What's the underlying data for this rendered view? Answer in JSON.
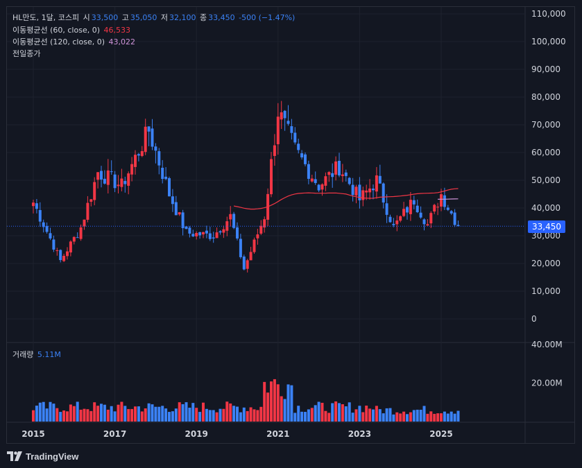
{
  "header": {
    "symbol": "HL만도, 1달, 코스피",
    "open_label": "시",
    "open": "33,500",
    "high_label": "고",
    "high": "35,050",
    "low_label": "저",
    "low": "32,100",
    "close_label": "종",
    "close": "33,450",
    "change": "-500 (−1.47%)"
  },
  "indicators": [
    {
      "label": "이동평균선 (60, close, 0)",
      "value": "46,533",
      "color": "#f23645"
    },
    {
      "label": "이동평균선 (120, close, 0)",
      "value": "43,022",
      "color": "#ce93d8"
    },
    {
      "label": "전일종가",
      "value": "",
      "color": "#d1d4dc"
    }
  ],
  "volume_pane": {
    "label": "거래량",
    "value": "5.11M"
  },
  "current_price_tag": "33,450",
  "brand": "TradingView",
  "colors": {
    "up": "#f23645",
    "down": "#3b82f6",
    "ma60": "#f23645",
    "ma120": "#ce93d8",
    "grid": "#1e222d",
    "axis_text": "#d1d4dc"
  },
  "chart_data": {
    "type": "candlestick",
    "price_axis": {
      "ticks": [
        "110,000",
        "100,000",
        "90,000",
        "80,000",
        "70,000",
        "60,000",
        "50,000",
        "40,000",
        "30,000",
        "20,000",
        "10,000",
        "0"
      ],
      "range": [
        0,
        110000
      ]
    },
    "volume_axis": {
      "ticks": [
        "40.00M",
        "20.00M"
      ],
      "range": [
        0,
        40000000
      ]
    },
    "x_axis": {
      "ticks": [
        "2015",
        "2017",
        "2019",
        "2021",
        "2023",
        "2025"
      ]
    },
    "last_close": 33450,
    "yearly_path": [
      {
        "date": "2015-01",
        "price": 42000
      },
      {
        "date": "2015-06",
        "price": 29000
      },
      {
        "date": "2015-09",
        "price": 21000
      },
      {
        "date": "2016-03",
        "price": 33000
      },
      {
        "date": "2016-08",
        "price": 53000
      },
      {
        "date": "2017-03",
        "price": 48000
      },
      {
        "date": "2017-11",
        "price": 68000
      },
      {
        "date": "2018-05",
        "price": 45000
      },
      {
        "date": "2018-10",
        "price": 31000
      },
      {
        "date": "2019-06",
        "price": 30000
      },
      {
        "date": "2019-11",
        "price": 37000
      },
      {
        "date": "2020-03",
        "price": 18000
      },
      {
        "date": "2020-09",
        "price": 37000
      },
      {
        "date": "2021-01",
        "price": 75000
      },
      {
        "date": "2021-06",
        "price": 61000
      },
      {
        "date": "2022-01",
        "price": 48000
      },
      {
        "date": "2022-07",
        "price": 55000
      },
      {
        "date": "2023-01",
        "price": 43000
      },
      {
        "date": "2023-06",
        "price": 50000
      },
      {
        "date": "2023-11",
        "price": 33000
      },
      {
        "date": "2024-05",
        "price": 43000
      },
      {
        "date": "2024-09",
        "price": 34000
      },
      {
        "date": "2025-01",
        "price": 45000
      },
      {
        "date": "2025-06",
        "price": 33450
      }
    ]
  }
}
